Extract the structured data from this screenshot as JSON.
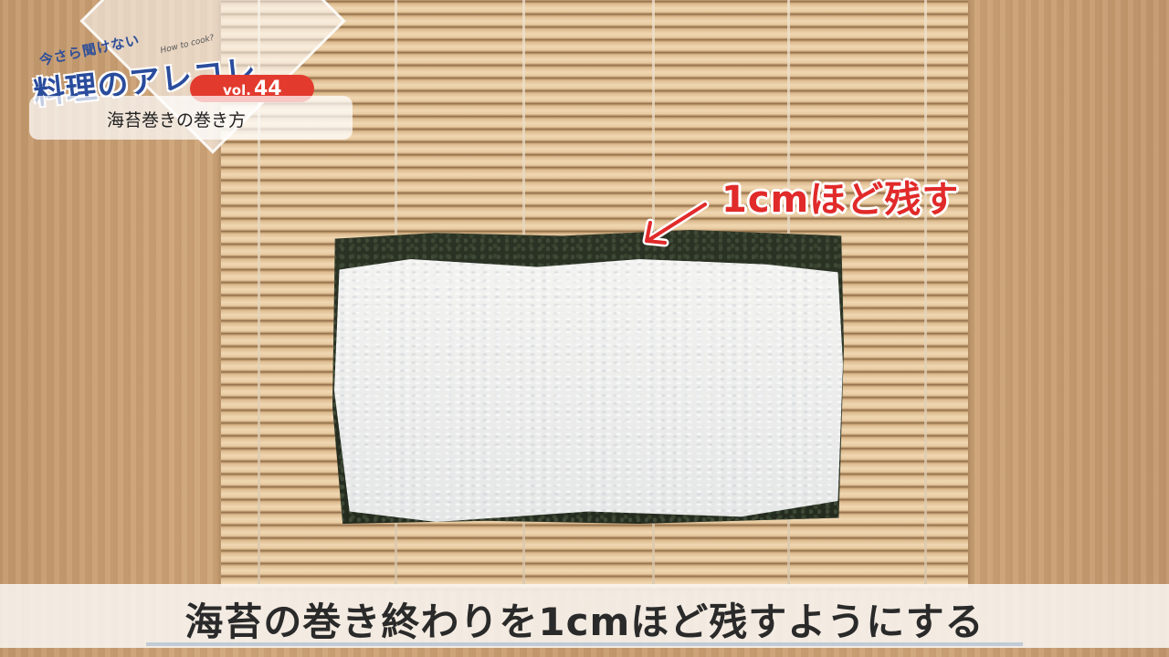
{
  "logo": {
    "small_text": "今さら聞けない",
    "main_text": "料理のアレコレ",
    "sub_text": "How to cook?",
    "vol_prefix": "vol.",
    "vol_number": "44",
    "episode_title": "海苔巻きの巻き方"
  },
  "annotation": {
    "text": "1cmほど残す",
    "color": "#e12a2a"
  },
  "subtitle": {
    "text": "海苔の巻き終わりを1cmほど残すようにする"
  },
  "colors": {
    "brand_blue": "#2a4c9c",
    "badge_red": "#e23b2e"
  }
}
